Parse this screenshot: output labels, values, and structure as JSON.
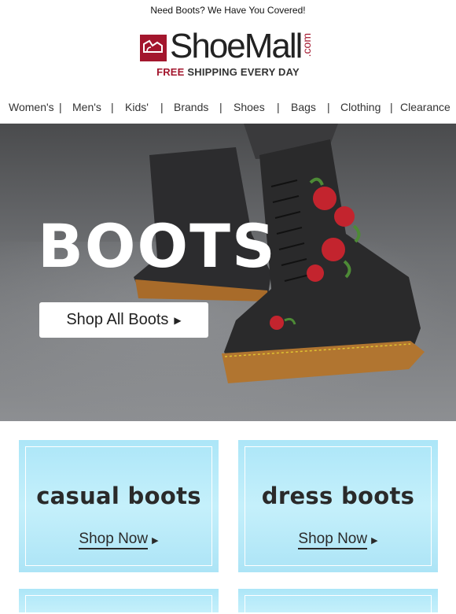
{
  "preheader": "Need Boots? We Have You Covered!",
  "logo": {
    "name": "ShoeMall",
    "suffix": ".com",
    "tagline_red": "FREE",
    "tagline_rest": "SHIPPING EVERY DAY"
  },
  "nav": {
    "items": [
      "Women's",
      "Men's",
      "Kids'",
      "Brands",
      "Shoes",
      "Bags",
      "Clothing",
      "Clearance"
    ],
    "separator": "|"
  },
  "hero": {
    "title": "BOOTS",
    "button_label": "Shop All Boots",
    "button_arrow": "▶"
  },
  "cards": [
    {
      "label": "casual boots",
      "cta": "Shop Now",
      "arrow": "▶"
    },
    {
      "label": "dress boots",
      "cta": "Shop Now",
      "arrow": "▶"
    }
  ],
  "colors": {
    "brand_red": "#a3162d",
    "card_bg": "#ace6f8"
  }
}
